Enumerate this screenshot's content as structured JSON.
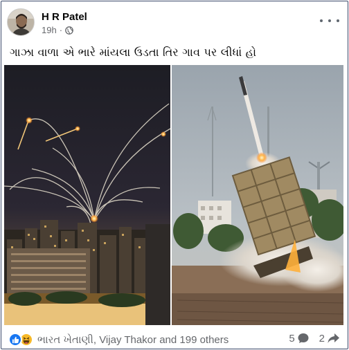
{
  "post": {
    "author": "H R Patel",
    "time": "19h",
    "separator": "·",
    "privacy_icon": "globe-icon",
    "menu_icon": "more-horizontal-icon",
    "caption": "ગાઝા વાળા એ ભારે માંયલા ઉડતા તિર ગાવ પર લીધાં હો"
  },
  "image": {
    "left_panel": "night sky with interceptor missile trails over city buildings",
    "right_panel": "missile launching from a launcher battery with smoke"
  },
  "footer": {
    "reaction_icons": [
      "like-icon",
      "haha-icon"
    ],
    "reactors": "ભારત ખેતાણી, Vijay Thakor and 199 others",
    "comments_count": "5",
    "shares_count": "2",
    "comment_icon": "comment-icon",
    "share_icon": "share-icon"
  },
  "colors": {
    "like_blue": "#1877f2",
    "haha_yellow": "#f7b928",
    "secondary_text": "#65676b"
  }
}
